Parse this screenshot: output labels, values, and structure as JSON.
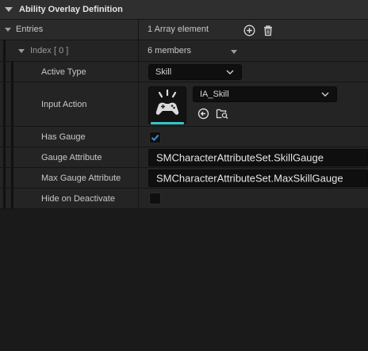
{
  "section": {
    "title": "Ability Overlay Definition"
  },
  "entries": {
    "label": "Entries",
    "count_text": "1 Array element"
  },
  "index_row": {
    "label": "Index [ 0 ]",
    "members_text": "6 members"
  },
  "properties": {
    "active_type": {
      "label": "Active Type",
      "value": "Skill"
    },
    "input_action": {
      "label": "Input Action",
      "value": "IA_Skill"
    },
    "has_gauge": {
      "label": "Has Gauge",
      "checked": true
    },
    "gauge_attribute": {
      "label": "Gauge Attribute",
      "value": "SMCharacterAttributeSet.SkillGauge"
    },
    "max_gauge_attribute": {
      "label": "Max Gauge Attribute",
      "value": "SMCharacterAttributeSet.MaxSkillGauge"
    },
    "hide_on_deactivate": {
      "label": "Hide on Deactivate",
      "checked": false
    }
  },
  "icons": {
    "add": "plus-circle-icon",
    "delete": "trash-icon",
    "browse": "browse-arrow-icon",
    "find": "find-in-content-browser-icon",
    "gamepad": "gamepad-icon"
  },
  "colors": {
    "accent": "#39c4c7",
    "check": "#3a8fe0"
  }
}
